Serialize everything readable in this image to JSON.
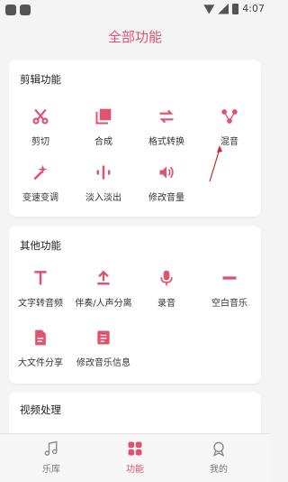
{
  "status_bar": {
    "time": "4:07"
  },
  "page": {
    "title": "全部功能"
  },
  "sections": [
    {
      "title": "剪辑功能",
      "items": [
        {
          "label": "剪切",
          "icon": "scissors-icon"
        },
        {
          "label": "合成",
          "icon": "merge-icon"
        },
        {
          "label": "格式转换",
          "icon": "convert-arrows-icon"
        },
        {
          "label": "混音",
          "icon": "mix-icon"
        },
        {
          "label": "变速变调",
          "icon": "magic-wand-icon"
        },
        {
          "label": "淡入淡出",
          "icon": "waveform-icon"
        },
        {
          "label": "修改音量",
          "icon": "volume-icon"
        }
      ]
    },
    {
      "title": "其他功能",
      "items": [
        {
          "label": "文字转音频",
          "icon": "text-t-icon"
        },
        {
          "label": "伴奏/人声分离",
          "icon": "upload-icon"
        },
        {
          "label": "录音",
          "icon": "microphone-icon"
        },
        {
          "label": "空白音乐",
          "icon": "minus-bar-icon"
        },
        {
          "label": "大文件分享",
          "icon": "file-icon"
        },
        {
          "label": "修改音乐信息",
          "icon": "document-icon"
        }
      ]
    },
    {
      "title": "视频处理",
      "items": []
    }
  ],
  "tabbar": [
    {
      "label": "乐库",
      "icon": "music-note-icon",
      "active": false
    },
    {
      "label": "功能",
      "icon": "grid-icon",
      "active": true
    },
    {
      "label": "我的",
      "icon": "profile-icon",
      "active": false
    }
  ],
  "colors": {
    "accent": "#e1526e",
    "background": "#f4f4f4",
    "card": "#ffffff"
  }
}
